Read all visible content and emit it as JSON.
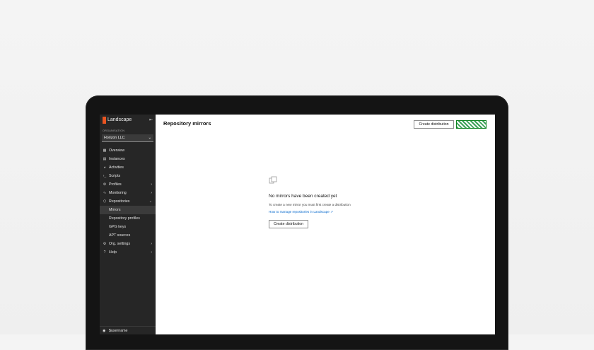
{
  "app": {
    "name": "Landscape"
  },
  "sidebar": {
    "collapse_icon": "collapse-icon",
    "org_label": "ORGANISATION",
    "org_value": "Horizon LLC",
    "items": [
      {
        "label": "Overview",
        "icon": "overview-icon"
      },
      {
        "label": "Instances",
        "icon": "instances-icon"
      },
      {
        "label": "Activities",
        "icon": "activities-icon"
      },
      {
        "label": "Scripts",
        "icon": "scripts-icon"
      },
      {
        "label": "Profiles",
        "icon": "profiles-icon"
      },
      {
        "label": "Monitoring",
        "icon": "monitoring-icon"
      },
      {
        "label": "Repositories",
        "icon": "repositories-icon"
      }
    ],
    "repo_sub": [
      {
        "label": "Mirrors"
      },
      {
        "label": "Repository profiles"
      },
      {
        "label": "GPG keys"
      },
      {
        "label": "APT sources"
      }
    ],
    "bottom_items": [
      {
        "label": "Org. settings",
        "icon": "settings-icon"
      },
      {
        "label": "Help",
        "icon": "help-icon"
      }
    ],
    "user": "$username"
  },
  "main": {
    "title": "Repository mirrors",
    "create_button": "Create distribution",
    "empty": {
      "title": "No mirrors have been created yet",
      "description": "To create a new mirror you must first create a distribution",
      "link": "How to manage repositories in Landscape",
      "button": "Create distribution"
    }
  },
  "colors": {
    "accent": "#e95420",
    "sidebar_bg": "#262626",
    "link": "#0066cc",
    "positive": "#0e8420"
  }
}
